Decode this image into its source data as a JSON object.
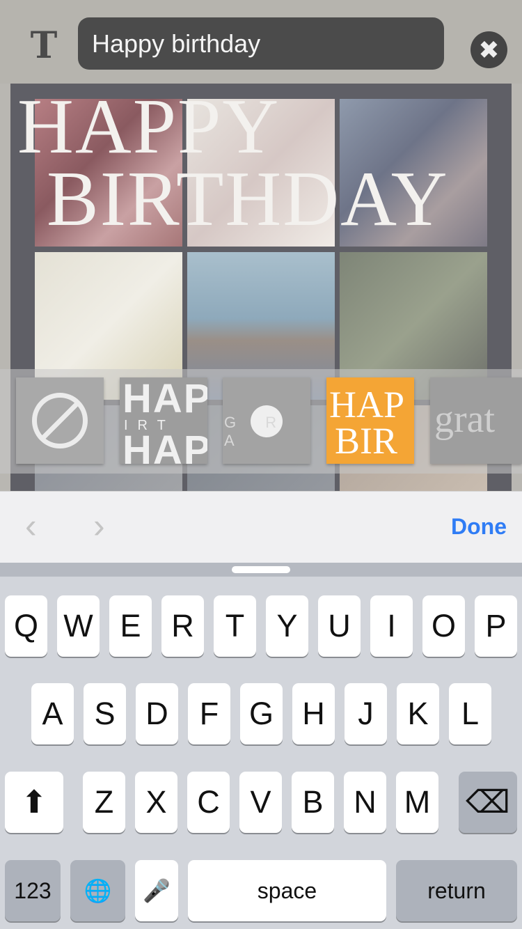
{
  "top_bar": {
    "text_tool_icon": "T",
    "text_value": "Happy birthday",
    "close_icon": "✖"
  },
  "canvas": {
    "headline_line1": "Happy",
    "headline_line2": "Birthday"
  },
  "style_strip": {
    "items": [
      {
        "name": "none"
      },
      {
        "text_top": "HAP",
        "text_mid": "IRT",
        "text_bottom": "HAP"
      },
      {
        "text": "G R A"
      },
      {
        "text_top": "HAP",
        "text_bottom": "BIR",
        "selected": true,
        "color": "#f4a535"
      },
      {
        "text": "grat"
      }
    ]
  },
  "toolbar": {
    "prev_icon": "‹",
    "next_icon": "›",
    "done_label": "Done"
  },
  "keyboard": {
    "row1": [
      "Q",
      "W",
      "E",
      "R",
      "T",
      "Y",
      "U",
      "I",
      "O",
      "P"
    ],
    "row2": [
      "A",
      "S",
      "D",
      "F",
      "G",
      "H",
      "J",
      "K",
      "L"
    ],
    "row3": [
      "Z",
      "X",
      "C",
      "V",
      "B",
      "N",
      "M"
    ],
    "shift_icon": "⬆",
    "delete_icon": "⌫",
    "numbers_label": "123",
    "globe_icon": "🌐",
    "mic_icon": "🎤",
    "space_label": "space",
    "return_label": "return"
  }
}
